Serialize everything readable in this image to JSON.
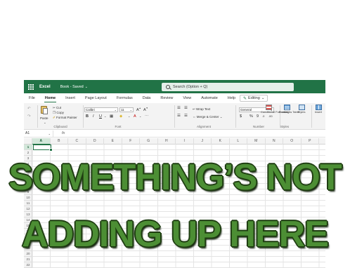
{
  "titlebar": {
    "app_name": "Excel",
    "doc_name": "Book - Saved",
    "search_placeholder": "Search (Option + Q)"
  },
  "menu": {
    "tabs": [
      "File",
      "Home",
      "Insert",
      "Page Layout",
      "Formulas",
      "Data",
      "Review",
      "View",
      "Automate",
      "Help"
    ],
    "active_tab": "Home",
    "mode_label": "Editing"
  },
  "ribbon": {
    "clipboard": {
      "label": "Clipboard",
      "paste": "Paste",
      "cut": "Cut",
      "copy": "Copy",
      "format_painter": "Format Painter"
    },
    "font": {
      "label": "Font",
      "font_name": "Calibri",
      "font_size": "11",
      "bold": "B",
      "italic": "I",
      "underline": "U"
    },
    "alignment": {
      "label": "Alignment",
      "wrap_text": "Wrap Text",
      "merge_center": "Merge & Center"
    },
    "number": {
      "label": "Number",
      "format": "General",
      "currency": "$",
      "percent": "%",
      "comma": "9"
    },
    "styles": {
      "label": "Styles",
      "conditional": "Conditional Formatting",
      "format_as_table": "Format As Table",
      "styles": "Styles"
    },
    "cells": {
      "insert": "Insert"
    }
  },
  "formula_bar": {
    "name_box": "A1",
    "fx": "fx"
  },
  "grid": {
    "columns": [
      "A",
      "B",
      "C",
      "D",
      "E",
      "F",
      "G",
      "H",
      "I",
      "J",
      "K",
      "L",
      "M",
      "N",
      "O",
      "P"
    ],
    "rows": [
      "1",
      "2",
      "3",
      "4",
      "5",
      "6",
      "7",
      "8",
      "9",
      "10",
      "11",
      "12",
      "13",
      "14",
      "15",
      "16",
      "17",
      "18",
      "19",
      "20",
      "21",
      "22"
    ],
    "selected_cell": "A1"
  },
  "meme": {
    "line1": "SOMETHING’S NOT",
    "line2": "ADDING UP HERE"
  },
  "colors": {
    "excel_green": "#217346",
    "meme_green": "#4c8e34"
  }
}
